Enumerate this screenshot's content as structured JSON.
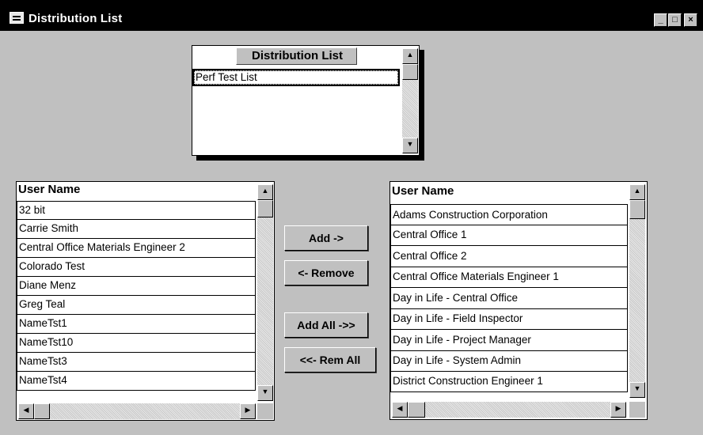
{
  "window": {
    "title": "Distribution List",
    "controls": [
      "_",
      "□",
      "×"
    ]
  },
  "dist_list": {
    "header": "Distribution List",
    "items": [
      "Perf Test List"
    ]
  },
  "left_list": {
    "header": "User Name",
    "items": [
      "32 bit",
      "Carrie Smith",
      "Central Office Materials Engineer 2",
      "Colorado Test",
      "Diane Menz",
      "Greg Teal",
      "NameTst1",
      "NameTst10",
      "NameTst3",
      "NameTst4"
    ]
  },
  "right_list": {
    "header": "User Name",
    "items": [
      "Adams Construction Corporation",
      "Central Office 1",
      "Central Office 2",
      "Central Office Materials Engineer 1",
      "Day in Life - Central Office",
      "Day in Life - Field Inspector",
      "Day in Life - Project Manager",
      "Day in Life - System Admin",
      "District Construction Engineer 1"
    ]
  },
  "buttons": {
    "add": "Add ->",
    "remove": "<- Remove",
    "add_all": "Add All ->>",
    "rem_all": "<<- Rem All"
  },
  "scroll_glyphs": {
    "up": "▲",
    "down": "▼",
    "left": "◀",
    "right": "▶"
  },
  "icons": {
    "app": "app-icon",
    "minimize": "minimize-icon",
    "maximize": "maximize-icon",
    "close": "close-icon"
  }
}
